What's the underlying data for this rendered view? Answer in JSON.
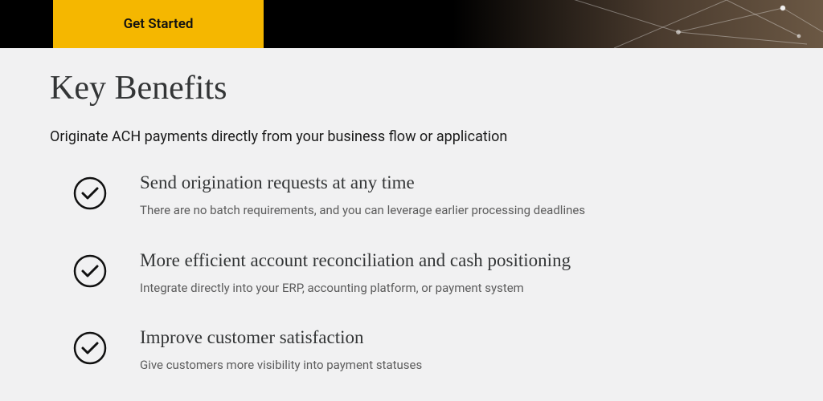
{
  "hero": {
    "cta_label": "Get Started"
  },
  "section": {
    "heading": "Key Benefits",
    "subheading": "Originate ACH payments directly from your business flow or application",
    "benefits": [
      {
        "title": "Send origination requests at any time",
        "desc": "There are no batch requirements, and you can leverage earlier processing deadlines"
      },
      {
        "title": "More efficient account reconciliation and cash positioning",
        "desc": "Integrate directly into your ERP, accounting platform, or payment system"
      },
      {
        "title": "Improve customer satisfaction",
        "desc": "Give customers more visibility into payment statuses"
      }
    ]
  }
}
